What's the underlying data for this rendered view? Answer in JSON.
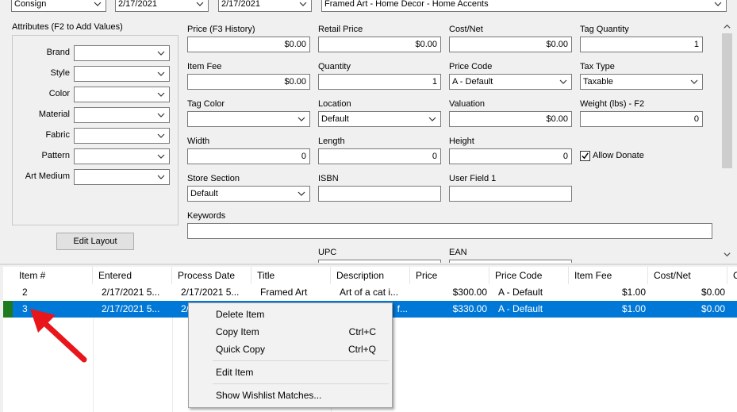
{
  "top": {
    "consign": "Consign",
    "date1": "2/17/2021",
    "date2": "2/17/2021",
    "category": "Framed Art - Home Decor - Home Accents"
  },
  "attributes": {
    "title": "Attributes (F2 to Add Values)",
    "items": [
      "Brand",
      "Style",
      "Color",
      "Material",
      "Fabric",
      "Pattern",
      "Art Medium"
    ],
    "edit_layout": "Edit Layout"
  },
  "fields": {
    "price_label": "Price (F3 History)",
    "price": "$0.00",
    "retail_label": "Retail Price",
    "retail": "$0.00",
    "cost_label": "Cost/Net",
    "cost": "$0.00",
    "tagqty_label": "Tag Quantity",
    "tagqty": "1",
    "itemfee_label": "Item Fee",
    "itemfee": "$0.00",
    "qty_label": "Quantity",
    "qty": "1",
    "pricecode_label": "Price Code",
    "pricecode": "A - Default",
    "taxtype_label": "Tax Type",
    "taxtype": "Taxable",
    "tagcolor_label": "Tag Color",
    "tagcolor": "",
    "location_label": "Location",
    "location": "Default",
    "valuation_label": "Valuation",
    "valuation": "$0.00",
    "weight_label": "Weight (lbs) - F2",
    "weight": "0",
    "width_label": "Width",
    "width": "0",
    "length_label": "Length",
    "length": "0",
    "height_label": "Height",
    "height": "0",
    "allow_donate": "Allow Donate",
    "storesection_label": "Store Section",
    "storesection": "Default",
    "isbn_label": "ISBN",
    "isbn": "",
    "userfield_label": "User Field 1",
    "userfield": "",
    "keywords_label": "Keywords",
    "keywords": "",
    "upc_label": "UPC",
    "ean_label": "EAN"
  },
  "grid": {
    "headers": [
      "Item #",
      "Entered",
      "Process Date",
      "Title",
      "Description",
      "Price",
      "Price Code",
      "Item Fee",
      "Cost/Net",
      "C"
    ],
    "rows": [
      [
        "2",
        "2/17/2021 5...",
        "2/17/2021 5...",
        "Framed Art",
        "Art of a cat i...",
        "$300.00",
        "A - Default",
        "$1.00",
        "$0.00"
      ],
      [
        "3",
        "2/17/2021 5...",
        "2/",
        "",
        "f...",
        "$330.00",
        "A - Default",
        "$1.00",
        "$0.00"
      ]
    ]
  },
  "context_menu": {
    "delete": "Delete Item",
    "copy": "Copy Item",
    "copy_sc": "Ctrl+C",
    "quick": "Quick Copy",
    "quick_sc": "Ctrl+Q",
    "edit": "Edit Item",
    "wishlist": "Show Wishlist Matches..."
  },
  "colors": {
    "selection": "#0078d7",
    "arrow": "#e8161b",
    "green_marker": "#1e7a1e"
  }
}
